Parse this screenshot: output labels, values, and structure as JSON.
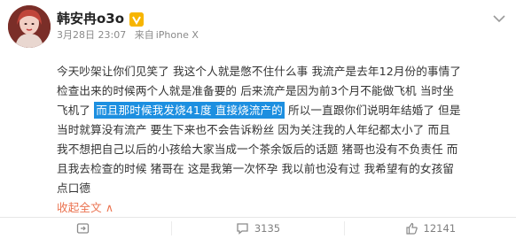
{
  "header": {
    "username": "韩安冉o3o",
    "time": "3月28日 23:07",
    "source_prefix": "来自",
    "device": "iPhone X"
  },
  "post": {
    "lines": [
      "今天吵架让你们见笑了 我这个人就是憋不住什么事 我流产是去年12月份的事情了",
      "检查出来的时候两个人就是准备要的 后来流产是因为前3个月不能做飞机 当时坐",
      "所以一直跟你们说明年结婚了 但是",
      "当时就算没有流产 要生下来也不会告诉粉丝 因为关注我的人年纪都太小了 而且",
      "我不想把自己以后的小孩给大家当成一个茶余饭后的话题 猪哥也没有不负责任 而",
      "且我去检查的时候 猪哥在 这是我第一次怀孕 我以前也没有过 我希望有的女孩留",
      "点口德"
    ],
    "line3_prefix": "飞机了",
    "highlight": "而且那时候我发烧41度 直接烧流产的",
    "collapse_label": "收起全文",
    "collapse_arrow": "∧"
  },
  "footer": {
    "repost_count": "",
    "comment_count": "3135",
    "like_count": "12141"
  }
}
